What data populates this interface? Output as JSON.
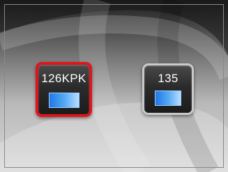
{
  "formats": [
    {
      "label": "126KPK",
      "selected": true,
      "icon": "film-cartridge-icon"
    },
    {
      "label": "135",
      "selected": false,
      "icon": "film-cartridge-icon"
    }
  ],
  "colors": {
    "selected_border": "#e0151c",
    "unselected_border": "#c9c9c9",
    "tile_background": "#2b2b2b",
    "film_gradient": [
      "#1f78e6",
      "#b8ddff"
    ]
  }
}
